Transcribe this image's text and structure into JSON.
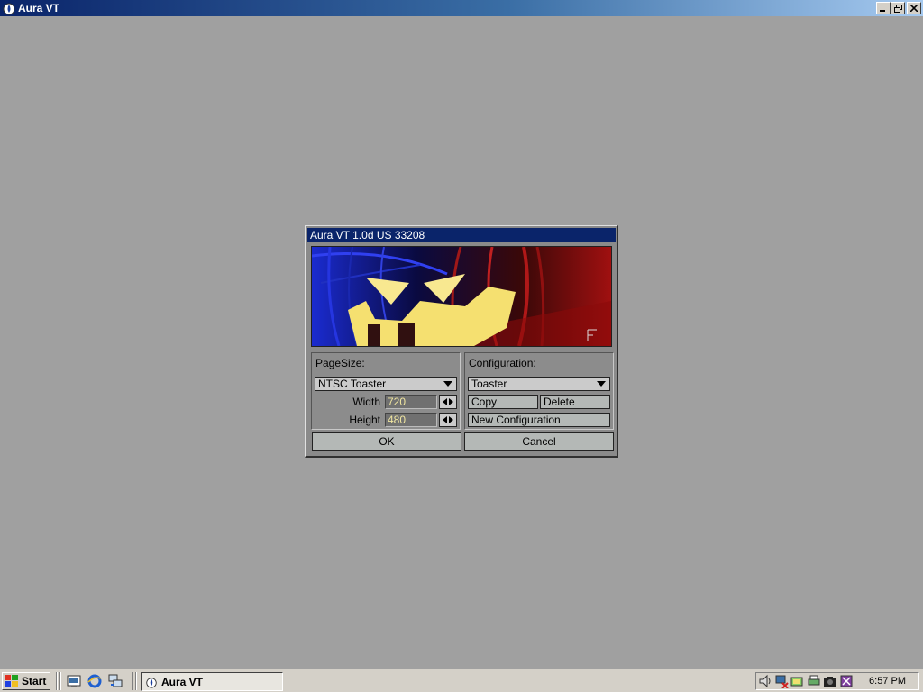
{
  "window": {
    "title": "Aura VT",
    "icon": "aura-icon"
  },
  "dialog": {
    "title": "Aura VT 1.0d US 33208",
    "banner": "jack-o-lantern-splash-image",
    "pagesize": {
      "label": "PageSize:",
      "selected": "NTSC Toaster",
      "width_label": "Width",
      "width_value": "720",
      "height_label": "Height",
      "height_value": "480"
    },
    "configuration": {
      "label": "Configuration:",
      "selected": "Toaster",
      "copy_label": "Copy",
      "delete_label": "Delete",
      "new_label": "New Configuration"
    },
    "ok_label": "OK",
    "cancel_label": "Cancel"
  },
  "taskbar": {
    "start_label": "Start",
    "quick_launch": [
      "show-desktop-icon",
      "internet-explorer-icon",
      "network-icon"
    ],
    "task_label": "Aura VT",
    "tray_icons": [
      "volume-icon",
      "network-disconnected-icon",
      "display-icon",
      "printer-icon",
      "camera-icon",
      "app-tray-icon"
    ],
    "clock": "6:57 PM"
  },
  "colors": {
    "desktop": "#a0a0a0",
    "dialog_title": "#0a246a",
    "field_text": "#f0e6a0"
  }
}
